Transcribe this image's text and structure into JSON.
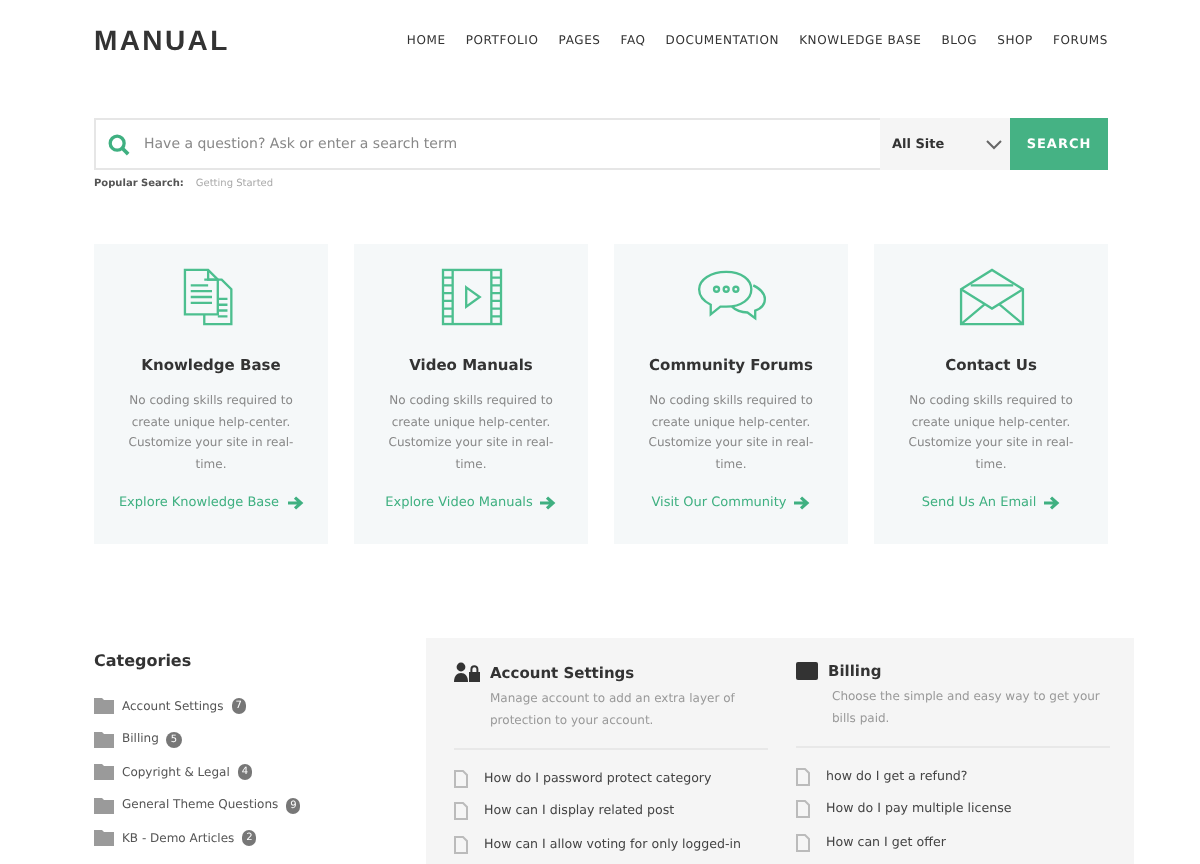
{
  "header": {
    "logo": "MANUAL",
    "nav": [
      {
        "label": "HOME"
      },
      {
        "label": "PORTFOLIO"
      },
      {
        "label": "PAGES"
      },
      {
        "label": "FAQ"
      },
      {
        "label": "DOCUMENTATION"
      },
      {
        "label": "KNOWLEDGE BASE"
      },
      {
        "label": "BLOG"
      },
      {
        "label": "SHOP"
      },
      {
        "label": "FORUMS"
      }
    ]
  },
  "search": {
    "placeholder": "Have a question? Ask or enter a search term",
    "scope": "All Site",
    "button": "SEARCH",
    "popular_label": "Popular Search:",
    "popular": "Getting Started"
  },
  "cards": [
    {
      "kind": "documents",
      "title": "Knowledge Base",
      "text": "No coding skills required to create unique help-center. Customize your site in real-time.",
      "link": "Explore Knowledge Base"
    },
    {
      "kind": "video",
      "title": "Video Manuals",
      "text": "No coding skills required to create unique help-center. Customize your site in real-time.",
      "link": "Explore Video Manuals"
    },
    {
      "kind": "chat",
      "title": "Community Forums",
      "text": "No coding skills required to create unique help-center. Customize your site in real-time.",
      "link": "Visit Our Community"
    },
    {
      "kind": "mail",
      "title": "Contact Us",
      "text": "No coding skills required to create unique help-center. Customize your site in real-time.",
      "link": "Send Us An Email"
    }
  ],
  "categories": {
    "title": "Categories",
    "items": [
      {
        "label": "Account Settings",
        "count": "7"
      },
      {
        "label": "Billing",
        "count": "5"
      },
      {
        "label": "Copyright & Legal",
        "count": "4"
      },
      {
        "label": "General Theme Questions",
        "count": "9"
      },
      {
        "label": "KB - Demo Articles",
        "count": "2"
      }
    ]
  },
  "sections": [
    {
      "kind": "account",
      "title": "Account Settings",
      "text": "Manage account to add an extra layer of protection to your account.",
      "articles": [
        "How do I password protect category",
        "How can I display related post",
        "How can I allow voting for only logged-in"
      ]
    },
    {
      "kind": "billing",
      "title": "Billing",
      "text": "Choose the simple and easy way to get your bills paid.",
      "articles": [
        "how do I get a refund?",
        "How do I pay multiple license",
        "How can I get offer"
      ]
    }
  ]
}
